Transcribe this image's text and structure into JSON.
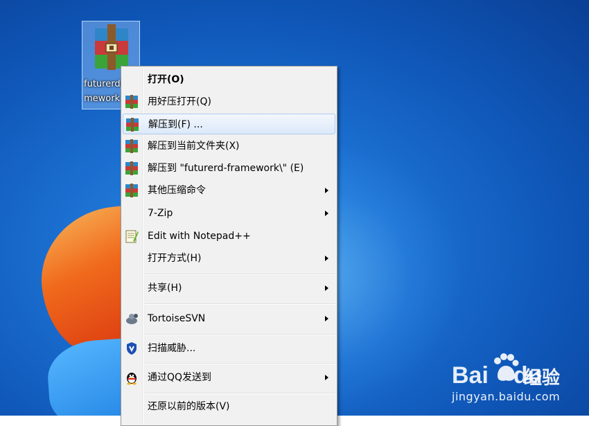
{
  "desktop_icon": {
    "name_line1": "futurerd-",
    "name_line2": "mework",
    "icon": "winrar-archive-icon"
  },
  "context_menu": {
    "items": [
      {
        "label": "打开(O)",
        "icon": null,
        "bold": true,
        "submenu": false
      },
      {
        "label": "用好压打开(Q)",
        "icon": "haozip-icon",
        "submenu": false
      },
      {
        "label": "解压到(F) ...",
        "icon": "haozip-icon",
        "submenu": false,
        "highlighted": true
      },
      {
        "label": "解压到当前文件夹(X)",
        "icon": "haozip-icon",
        "submenu": false
      },
      {
        "label": "解压到 \"futurerd-framework\\\" (E)",
        "icon": "haozip-icon",
        "submenu": false
      },
      {
        "label": "其他压缩命令",
        "icon": "haozip-icon",
        "submenu": true
      },
      {
        "label": "7-Zip",
        "icon": null,
        "submenu": true
      },
      {
        "label": "Edit with Notepad++",
        "icon": "notepad-plus-plus-icon",
        "submenu": false
      },
      {
        "label": "打开方式(H)",
        "icon": null,
        "submenu": true
      },
      {
        "label": "共享(H)",
        "icon": null,
        "submenu": true
      },
      {
        "label": "TortoiseSVN",
        "icon": "tortoisesvn-icon",
        "submenu": true
      },
      {
        "label": "扫描威胁...",
        "icon": "shield-icon",
        "submenu": false
      },
      {
        "label": "通过QQ发送到",
        "icon": "qq-penguin-icon",
        "submenu": true
      },
      {
        "label": "还原以前的版本(V)",
        "icon": null,
        "submenu": false
      }
    ]
  },
  "watermark": {
    "brand": "Bai",
    "brand_suffix": "du",
    "jingyan": "经验",
    "url": "jingyan.baidu.com"
  },
  "colors": {
    "desktop_blue": "#1b6fd0",
    "menu_bg": "#f1f1f1",
    "highlight_border": "#aecbf0"
  }
}
